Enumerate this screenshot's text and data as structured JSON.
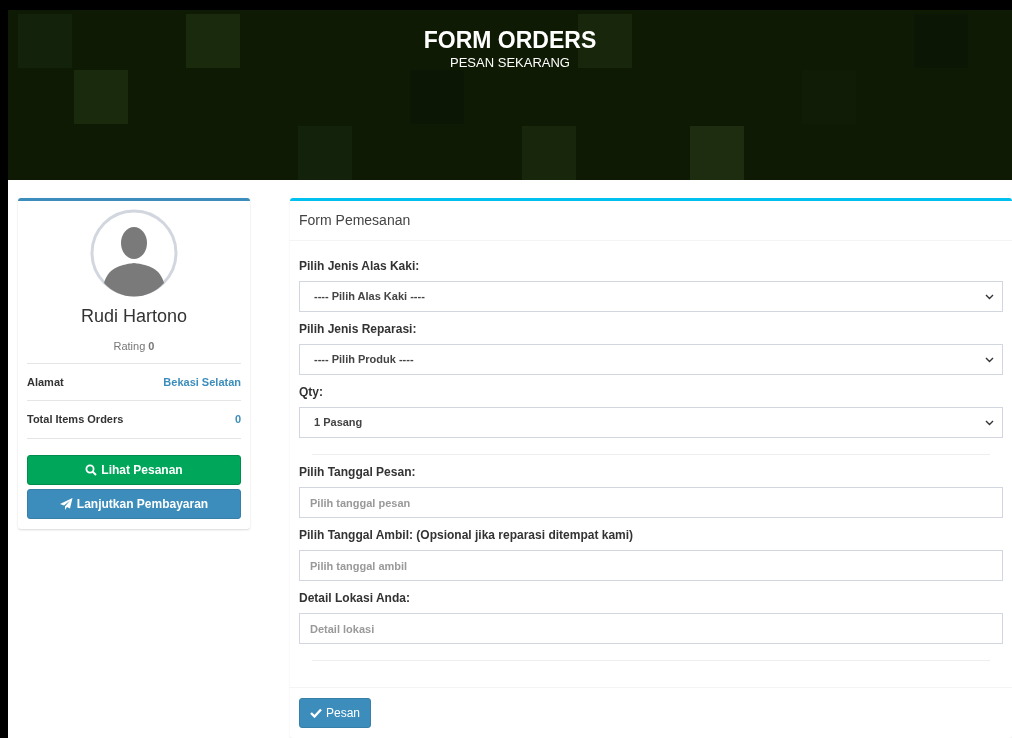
{
  "header": {
    "title": "FORM ORDERS",
    "subtitle": "PESAN SEKARANG"
  },
  "profile": {
    "name": "Rudi Hartono",
    "rating": "Rating **0**",
    "details": [
      {
        "label": "Alamat",
        "value": "Bekasi Selatan"
      },
      {
        "label": "Total Items Orders",
        "value": "0"
      }
    ],
    "buttons": [
      {
        "label": "Lihat Pesanan",
        "kind": "search"
      },
      {
        "label": "Lanjutkan Pembayaran",
        "kind": "send"
      }
    ]
  },
  "form": {
    "title": "Form Pemesanan",
    "sections": [
      {
        "fields": [
          {
            "kind": "select",
            "label": "Pilih Jenis Alas Kaki:",
            "value": "---- Pilih Alas Kaki ----"
          },
          {
            "kind": "select",
            "label": "Pilih Jenis Reparasi:",
            "value": "---- Pilih Produk ----"
          },
          {
            "kind": "select",
            "label": "Qty:",
            "value": "1 Pasang"
          }
        ]
      },
      {
        "fields": [
          {
            "kind": "input",
            "label": "Pilih Tanggal Pesan:",
            "placeholder": "Pilih tanggal pesan"
          },
          {
            "kind": "input",
            "label": "Pilih Tanggal Ambil: (Opsional jika reparasi ditempat kami)",
            "placeholder": "Pilih tanggal ambil"
          },
          {
            "kind": "input",
            "label": "Detail Lokasi Anda:",
            "placeholder": "Detail lokasi"
          }
        ]
      }
    ],
    "submit": {
      "label": "Pesan"
    }
  }
}
